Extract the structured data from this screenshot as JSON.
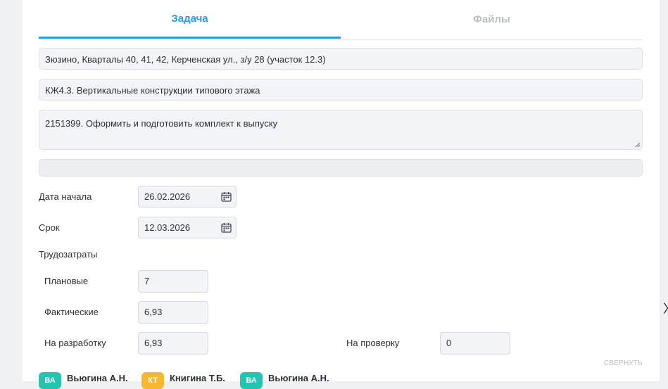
{
  "tabs": [
    {
      "label": "Задача",
      "active": true
    },
    {
      "label": "Файлы",
      "active": false
    }
  ],
  "task": {
    "address": "Зюзино, Кварталы 40, 41, 42, Керченская ул., з/у 28 (участок 12.3)",
    "section": "КЖ4.3. Вертикальные конструкции типового этажа",
    "description": "2151399. Оформить и подготовить комплект к выпуску",
    "extra": ""
  },
  "dates": {
    "start_label": "Дата начала",
    "start_value": "26.02.2026",
    "deadline_label": "Срок",
    "deadline_value": "12.03.2026",
    "calendar_icon": "calendar-icon"
  },
  "labor": {
    "title": "Трудозатраты",
    "planned_label": "Плановые",
    "planned_value": "7",
    "actual_label": "Фактические",
    "actual_value": "6,93",
    "development_label": "На разработку",
    "development_value": "6,93",
    "review_label": "На проверку",
    "review_value": "0"
  },
  "collapse_label": "СВЕРНУТЬ",
  "people": [
    {
      "initials": "ВА",
      "name": "Вьюгина А.Н.",
      "color": "#26c4b0"
    },
    {
      "initials": "КТ",
      "name": "Книгина Т.Б.",
      "color": "#f5b82e"
    },
    {
      "initials": "ВА",
      "name": "Вьюгина А.Н.",
      "color": "#26c4b0"
    }
  ],
  "colors": {
    "accent": "#2b9be6",
    "muted": "#b9bec6"
  }
}
